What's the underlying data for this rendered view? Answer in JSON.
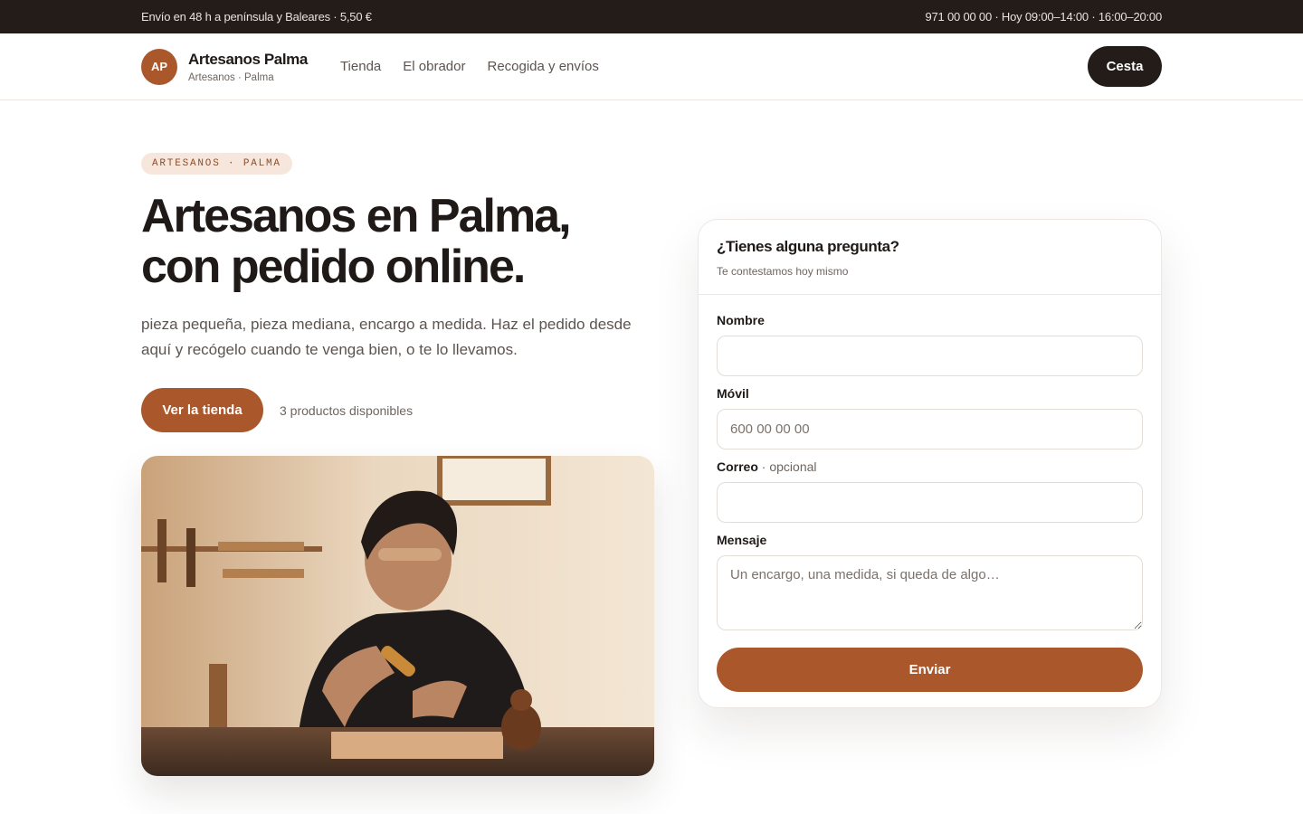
{
  "topbar": {
    "shipping": "Envío en 48 h a península y Baleares · 5,50 €",
    "contact": "971 00 00 00 · Hoy 09:00–14:00 · 16:00–20:00"
  },
  "header": {
    "logo_initials": "AP",
    "brand_name": "Artesanos Palma",
    "brand_sub": "Artesanos · Palma",
    "nav": [
      "Tienda",
      "El obrador",
      "Recogida y envíos"
    ],
    "cart_label": "Cesta"
  },
  "hero": {
    "pill": "ARTESANOS · PALMA",
    "headline_line1": "Artesanos en Palma,",
    "headline_line2": "con pedido online.",
    "lead": "pieza pequeña, pieza mediana, encargo a medida. Haz el pedido desde aquí y recógelo cuando te venga bien, o te lo llevamos.",
    "cta_label": "Ver la tienda",
    "availability": "3 productos disponibles"
  },
  "form": {
    "title": "¿Tienes alguna pregunta?",
    "subtitle": "Te contestamos hoy mismo",
    "name_label": "Nombre",
    "name_placeholder": "",
    "phone_label": "Móvil",
    "phone_placeholder": "600 00 00 00",
    "email_label": "Correo",
    "email_optional": " · opcional",
    "email_placeholder": "",
    "message_label": "Mensaje",
    "message_placeholder": "Un encargo, una medida, si queda de algo…",
    "submit_label": "Enviar"
  },
  "colors": {
    "accent": "#a9572b",
    "dark": "#231c18",
    "pill_bg": "#f6e6dc"
  },
  "icons": {
    "hero_image": "artisan-carving-wood-photo"
  }
}
